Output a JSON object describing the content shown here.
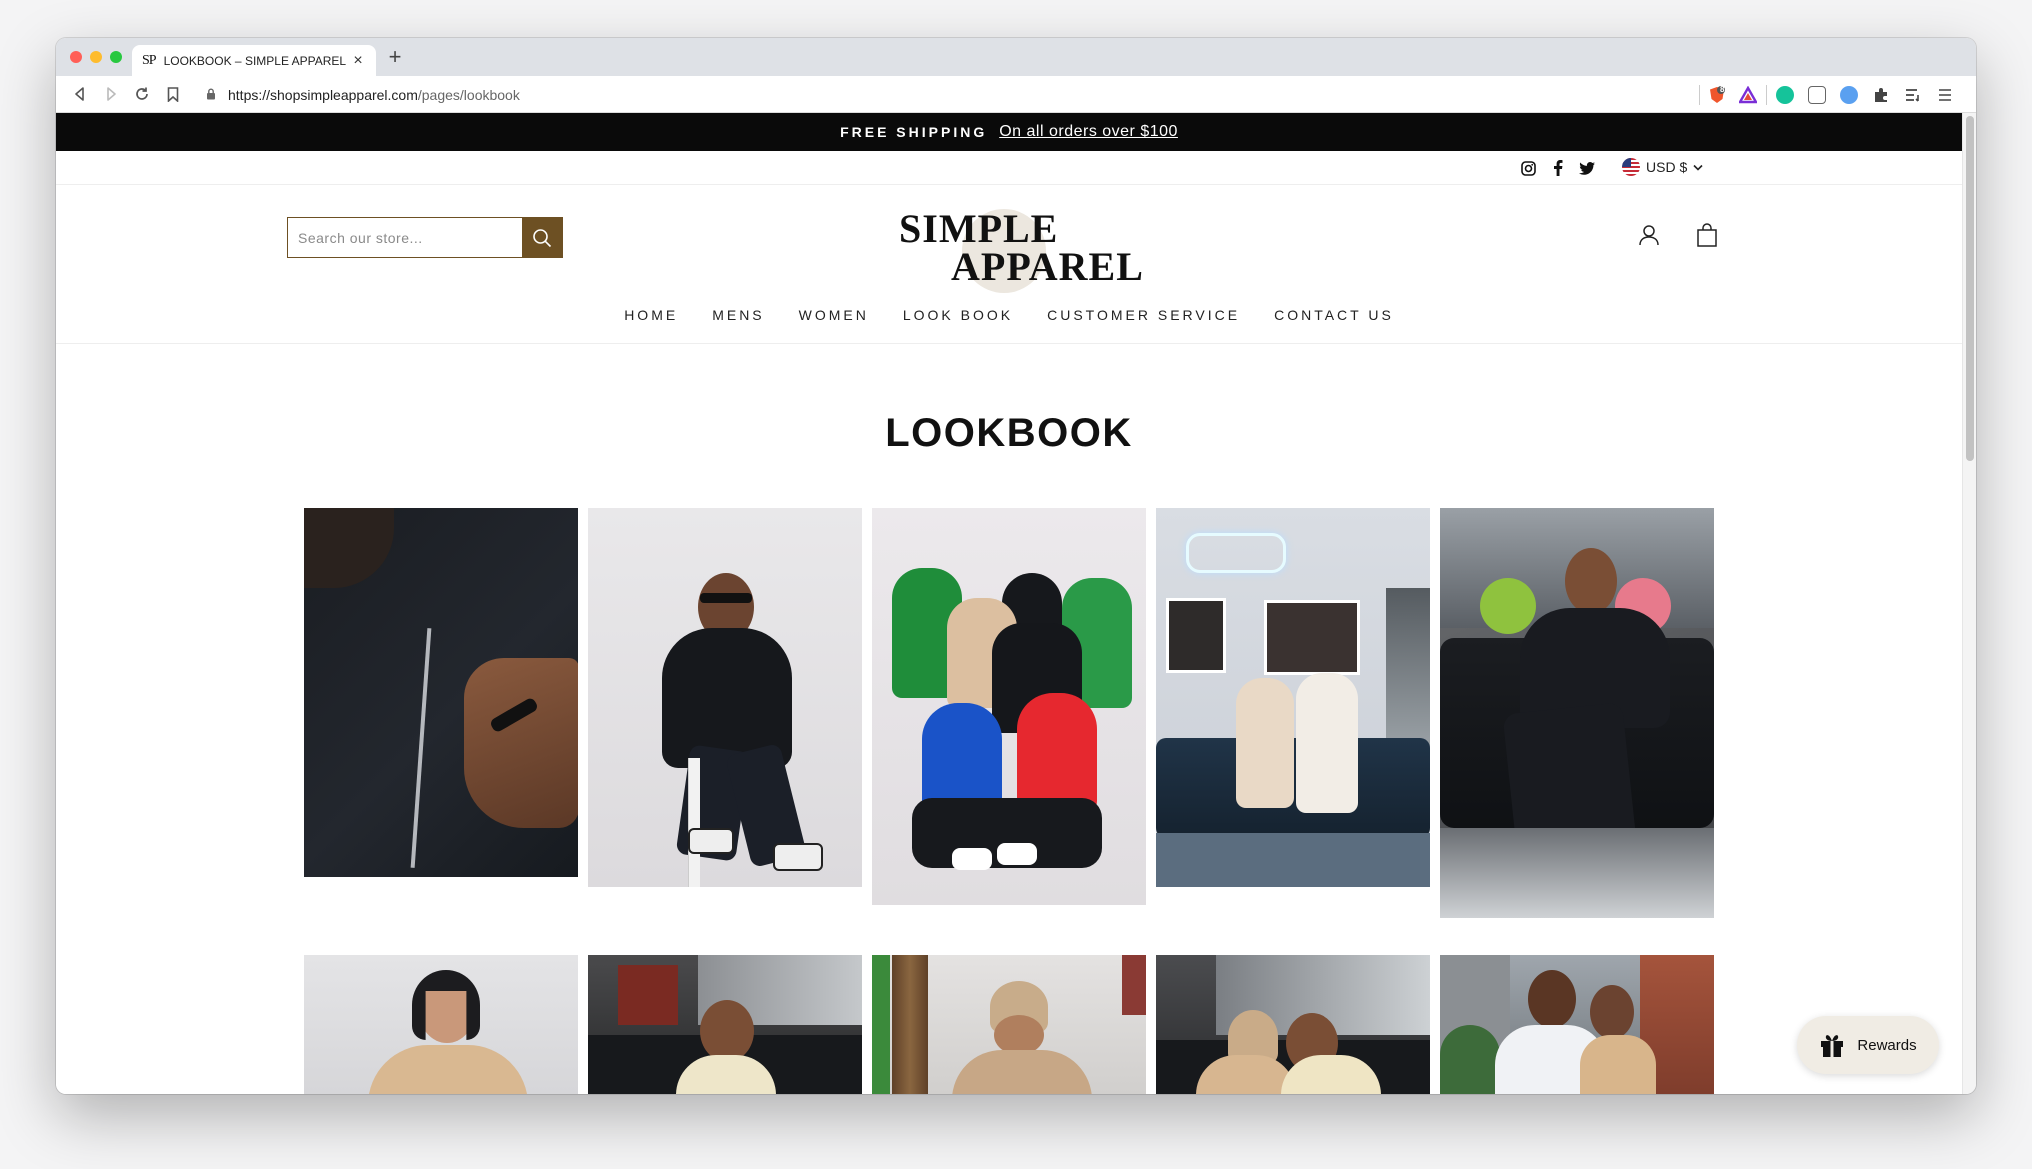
{
  "browser": {
    "tab_favicon": "SP",
    "tab_title": "LOOKBOOK – SIMPLE APPAREL",
    "url_host": "https://shopsimpleapparel.com",
    "url_path": "/pages/lookbook",
    "extension_badge": "8"
  },
  "announcement": {
    "bold_text": "FREE SHIPPING",
    "link_text": "On all orders over $100"
  },
  "utility": {
    "social_icons": [
      "instagram-icon",
      "facebook-icon",
      "twitter-icon"
    ],
    "currency": "USD $"
  },
  "header": {
    "search_placeholder": "Search our store...",
    "logo_line1": "SIMPLE",
    "logo_line2": "APPAREL"
  },
  "nav": {
    "items": [
      "HOME",
      "MENS",
      "WOMEN",
      "LOOK BOOK",
      "CUSTOMER SERVICE",
      "CONTACT US"
    ]
  },
  "main": {
    "title": "LOOKBOOK"
  },
  "lookbook": {
    "photos": [
      {
        "row": 1,
        "col": 1,
        "subject": "close-up hand on black hoodie with logo"
      },
      {
        "row": 1,
        "col": 2,
        "subject": "man in black hoodie on stool"
      },
      {
        "row": 1,
        "col": 3,
        "subject": "group in colored hoodies"
      },
      {
        "row": 1,
        "col": 4,
        "subject": "two women on leather couch"
      },
      {
        "row": 1,
        "col": 5,
        "subject": "woman in black sweatsuit on couch"
      },
      {
        "row": 2,
        "col": 1,
        "subject": "woman in tan sweatshirt"
      },
      {
        "row": 2,
        "col": 2,
        "subject": "woman on couch in cream set"
      },
      {
        "row": 2,
        "col": 3,
        "subject": "woman in tan beanie"
      },
      {
        "row": 2,
        "col": 4,
        "subject": "two women on couch"
      },
      {
        "row": 2,
        "col": 5,
        "subject": "couple outdoors"
      }
    ]
  },
  "rewards": {
    "label": "Rewards"
  },
  "colors": {
    "brand_brown": "#6d5023",
    "announce_bg": "#0a0a0a",
    "rewards_bg": "#f0ece4"
  }
}
